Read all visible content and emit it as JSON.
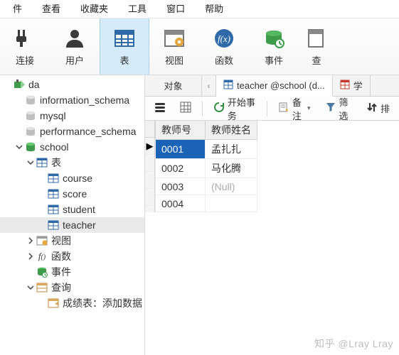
{
  "menubar": {
    "items": [
      "件",
      "查看",
      "收藏夹",
      "工具",
      "窗口",
      "帮助"
    ]
  },
  "ribbon": {
    "tools": [
      {
        "id": "connection",
        "label": "连接"
      },
      {
        "id": "user",
        "label": "用户"
      },
      {
        "id": "table",
        "label": "表",
        "active": true
      },
      {
        "id": "view",
        "label": "视图"
      },
      {
        "id": "function",
        "label": "函数"
      },
      {
        "id": "event",
        "label": "事件"
      },
      {
        "id": "query",
        "label": "查"
      }
    ]
  },
  "tree": {
    "items": [
      {
        "depth": 0,
        "icon": "conn-active",
        "label": "da",
        "exp": ""
      },
      {
        "depth": 1,
        "icon": "db",
        "label": "information_schema"
      },
      {
        "depth": 1,
        "icon": "db",
        "label": "mysql"
      },
      {
        "depth": 1,
        "icon": "db",
        "label": "performance_schema"
      },
      {
        "depth": 1,
        "icon": "db-open",
        "label": "school",
        "exp": "open"
      },
      {
        "depth": 2,
        "icon": "tables",
        "label": "表",
        "exp": "open"
      },
      {
        "depth": 3,
        "icon": "tbl",
        "label": "course"
      },
      {
        "depth": 3,
        "icon": "tbl",
        "label": "score"
      },
      {
        "depth": 3,
        "icon": "tbl",
        "label": "student"
      },
      {
        "depth": 3,
        "icon": "tbl",
        "label": "teacher",
        "sel": true
      },
      {
        "depth": 2,
        "icon": "views",
        "label": "视图",
        "exp": "closed"
      },
      {
        "depth": 2,
        "icon": "funcs",
        "label": "函数",
        "exp": "closed",
        "fo": true,
        "prefix": "f()"
      },
      {
        "depth": 2,
        "icon": "events",
        "label": "事件",
        "exp": ""
      },
      {
        "depth": 2,
        "icon": "queries",
        "label": "查询",
        "exp": "open"
      },
      {
        "depth": 3,
        "icon": "qry",
        "label": "成绩表：添加数据"
      }
    ]
  },
  "tabs": {
    "object_label": "对象",
    "open_tab": {
      "label": "teacher @school (d...",
      "icon": "tbl"
    },
    "extra_tab": {
      "label": "学",
      "icon": "tbl-alt"
    }
  },
  "innerbar": {
    "start_txn": "开始事务",
    "remark": "备注",
    "filter": "筛选",
    "sort": "排"
  },
  "grid": {
    "columns": [
      "教师号",
      "教师姓名"
    ],
    "rows": [
      {
        "cells": [
          "0001",
          "孟扎扎"
        ],
        "selected": true,
        "indicator": "▶"
      },
      {
        "cells": [
          "0002",
          "马化腾"
        ]
      },
      {
        "cells": [
          "0003",
          null
        ]
      },
      {
        "cells": [
          "0004",
          ""
        ]
      }
    ],
    "null_text": "(Null)"
  },
  "watermark": "知乎 @Lray Lray"
}
